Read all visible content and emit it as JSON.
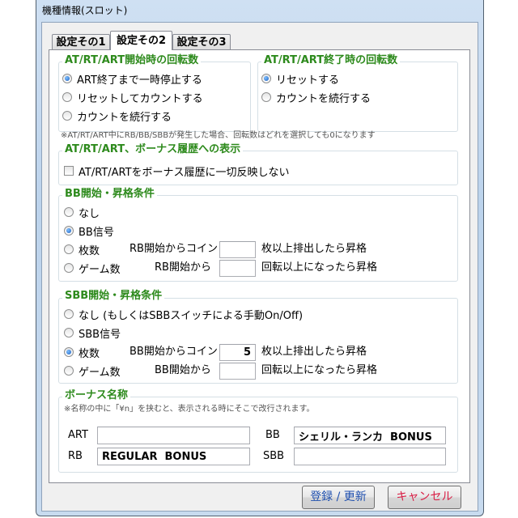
{
  "window": {
    "title": "機種情報(スロット)"
  },
  "colors": {
    "legend": "#2d8a1c",
    "radio_dot": "#1d5fc0",
    "register_text": "#1f4fae",
    "cancel_text": "#d81e45"
  },
  "tabs": [
    {
      "label": "設定その1",
      "active": false
    },
    {
      "label": "設定その2",
      "active": true
    },
    {
      "label": "設定その3",
      "active": false
    }
  ],
  "start_rotation": {
    "legend": "AT/RT/ART開始時の回転数",
    "options": [
      {
        "label": "ART終了まで一時停止する",
        "checked": true
      },
      {
        "label": "リセットしてカウントする",
        "checked": false
      },
      {
        "label": "カウントを続行する",
        "checked": false
      }
    ]
  },
  "end_rotation": {
    "legend": "AT/RT/ART終了時の回転数",
    "options": [
      {
        "label": "リセットする",
        "checked": true
      },
      {
        "label": "カウントを続行する",
        "checked": false
      }
    ]
  },
  "rotation_note": "※AT/RT/ART中にRB/BB/SBBが発生した場合、回転数はどれを選択しても0になります",
  "history_display": {
    "legend": "AT/RT/ART、ボーナス履歴への表示",
    "checkbox_label": "AT/RT/ARTをボーナス履歴に一切反映しない",
    "checked": false
  },
  "bb_condition": {
    "legend": "BB開始・昇格条件",
    "none": {
      "label": "なし",
      "checked": false
    },
    "signal": {
      "label": "BB信号",
      "checked": true
    },
    "coins": {
      "label": "枚数",
      "checked": false,
      "prefix": "RB開始からコイン",
      "value": "",
      "suffix": "枚以上排出したら昇格"
    },
    "games": {
      "label": "ゲーム数",
      "checked": false,
      "prefix": "RB開始から",
      "value": "",
      "suffix": "回転以上になったら昇格"
    }
  },
  "sbb_condition": {
    "legend": "SBB開始・昇格条件",
    "none": {
      "label": "なし (もしくはSBBスイッチによる手動On/Off)",
      "checked": false
    },
    "signal": {
      "label": "SBB信号",
      "checked": false
    },
    "coins": {
      "label": "枚数",
      "checked": true,
      "prefix": "BB開始からコイン",
      "value": "5",
      "suffix": "枚以上排出したら昇格"
    },
    "games": {
      "label": "ゲーム数",
      "checked": false,
      "prefix": "BB開始から",
      "value": "",
      "suffix": "回転以上になったら昇格"
    }
  },
  "bonus_names": {
    "legend": "ボーナス名称",
    "note": "※名称の中に「¥n」を挟むと、表示される時にそこで改行されます。",
    "art": {
      "label": "ART",
      "value": ""
    },
    "bb": {
      "label": "BB",
      "value": "シェリル・ランカ  BONUS"
    },
    "rb": {
      "label": "RB",
      "value": "REGULAR  BONUS"
    },
    "sbb": {
      "label": "SBB",
      "value": ""
    }
  },
  "buttons": {
    "register": "登録 / 更新",
    "cancel": "キャンセル"
  }
}
